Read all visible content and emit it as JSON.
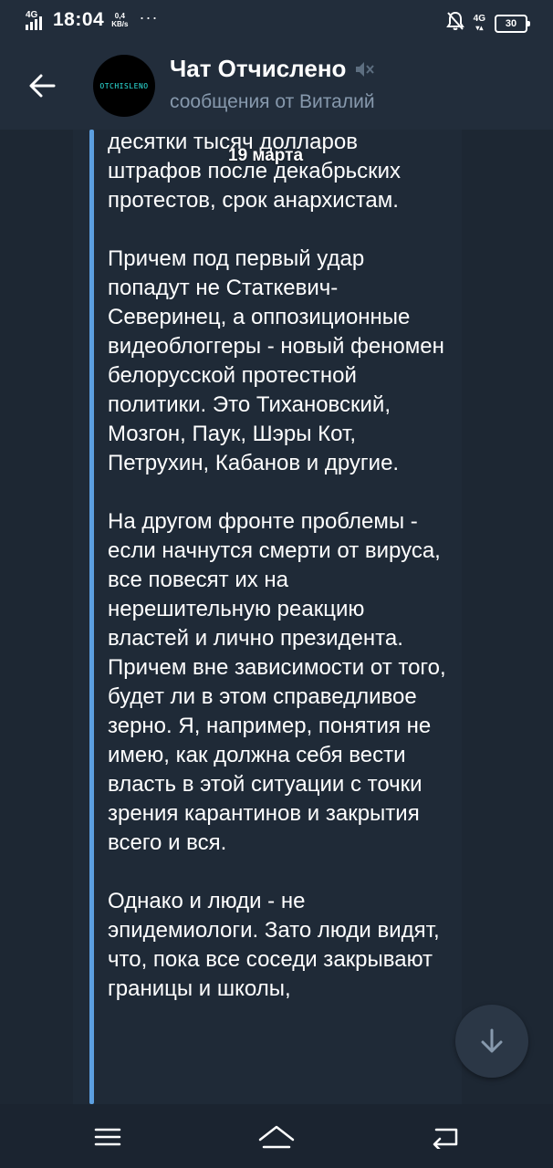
{
  "status_bar": {
    "network_left": "4G",
    "time": "18:04",
    "speed_value": "0,4",
    "speed_unit": "KB/s",
    "more": "···",
    "network_right": "4G",
    "battery": "30"
  },
  "header": {
    "title": "Чат Отчислено",
    "subtitle": "сообщения от Виталий",
    "avatar_text": "OTCHISLENO"
  },
  "date_label": "19 марта",
  "message": {
    "paragraphs": [
      "администрации президента, десятки тысяч долларов штрафов после декабрьских протестов, срок анархистам.",
      "Причем под первый удар попадут не Статкевич-Северинец, а оппозиционные видеоблоггеры - новый феномен белорусской протестной политики. Это Тихановский, Мозгон, Паук, Шэры Кот, Петрухин, Кабанов и другие.",
      "На другом фронте проблемы - если начнутся смерти от вируса, все повесят их на нерешительную реакцию властей и лично президента. Причем вне зависимости от того, будет ли в этом справедливое зерно. Я, например, понятия не имею, как должна себя вести власть в этой ситуации с точки зрения карантинов и закрытия всего и вся.",
      "Однако и люди - не эпидемиологи. Зато люди видят, что, пока все соседи закрывают границы и школы,"
    ]
  },
  "colors": {
    "background": "#1d2733",
    "header": "#222d3b",
    "accent": "#5c9fe0",
    "subtitle": "#8799ad"
  },
  "icons": {
    "back": "arrow-left-icon",
    "mute": "muted-speaker-icon",
    "scroll_down": "arrow-down-icon",
    "menu": "hamburger-menu-icon",
    "home": "home-chevron-icon",
    "back_nav": "return-arrow-icon"
  }
}
